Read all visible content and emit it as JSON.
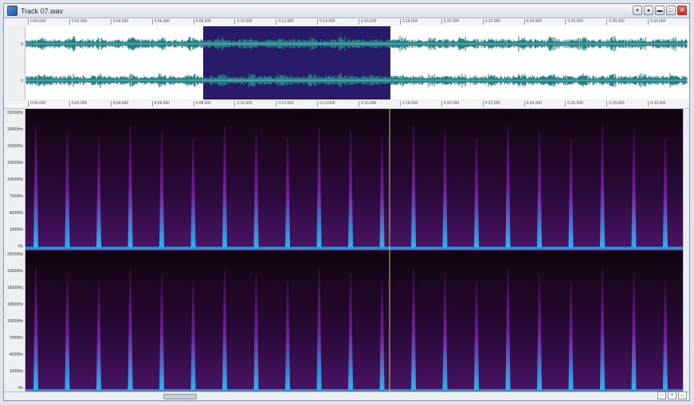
{
  "window": {
    "title": "Track 07.wav",
    "buttons": [
      "▾",
      "●",
      "▬",
      "□",
      "✕"
    ]
  },
  "timeline": {
    "labels": [
      "0:00.000",
      "0:02.000",
      "0:04.000",
      "0:06.000",
      "0:08.000",
      "0:10.000",
      "0:12.000",
      "0:14.000",
      "0:16.000",
      "0:18.000",
      "0:20.000",
      "0:22.000",
      "0:24.000",
      "0:26.000",
      "0:28.000",
      "0:30.000"
    ]
  },
  "waveform": {
    "scale_top": "0",
    "scale_bottom": "0"
  },
  "spectrogram": {
    "freq_labels_top": [
      "22050Hz",
      "19000Hz",
      "16000Hz",
      "13000Hz",
      "10000Hz",
      "7000Hz",
      "4000Hz",
      "1000Hz",
      "Hz"
    ],
    "freq_labels_bottom": [
      "22050Hz",
      "19000Hz",
      "16000Hz",
      "13000Hz",
      "10000Hz",
      "7000Hz",
      "4000Hz",
      "1000Hz",
      "Hz"
    ]
  },
  "colors": {
    "waveform": "#2a7f86",
    "waveform_highlight": "#7fffe8",
    "selection": "#2a1a6a",
    "spectro_base": "#2a0a3a",
    "spectro_mid": "#7b1fa2",
    "spectro_high": "#29b6f6"
  }
}
